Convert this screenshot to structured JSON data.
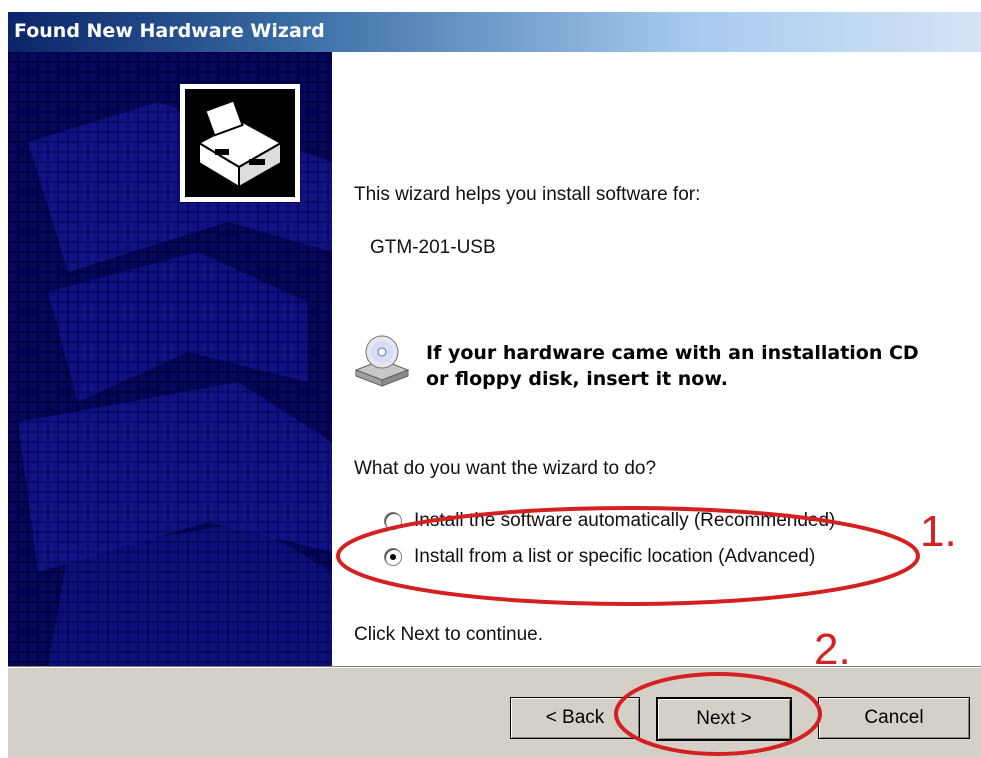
{
  "window": {
    "title": "Found New Hardware Wizard"
  },
  "content": {
    "intro": "This wizard helps you install software for:",
    "device_name": "GTM-201-USB",
    "cd_prompt": "If your hardware came with an installation CD or floppy disk, insert it now.",
    "question": "What do you want the wizard to do?",
    "options": [
      {
        "label": "Install the software automatically (Recommended)",
        "selected": false
      },
      {
        "label": "Install from a list or specific location (Advanced)",
        "selected": true
      }
    ],
    "continue_text": "Click Next to continue."
  },
  "buttons": {
    "back": "< Back",
    "next": "Next >",
    "cancel": "Cancel"
  },
  "annotations": {
    "step1": "1.",
    "step2": "2.",
    "color": "#d42020"
  },
  "icons": [
    "hardware-wizard-icon",
    "cd-drive-icon",
    "radio-icon"
  ]
}
